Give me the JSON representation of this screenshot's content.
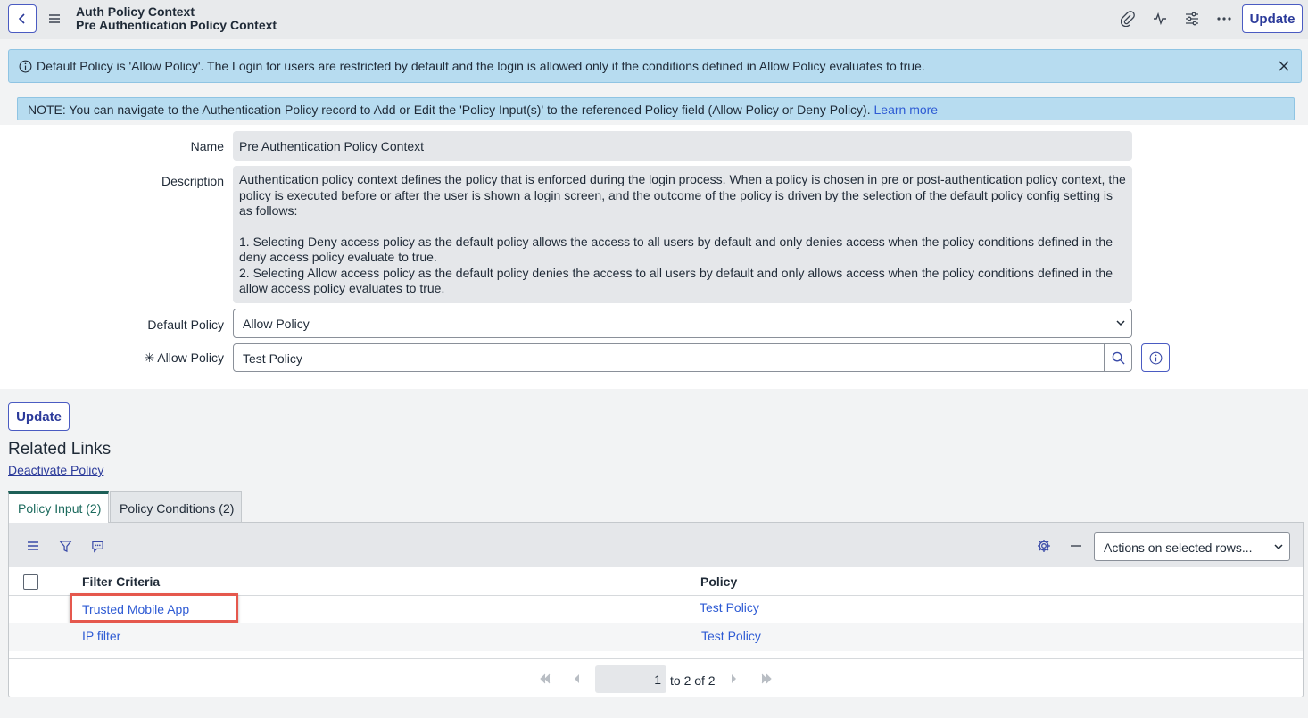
{
  "header": {
    "title": "Auth Policy Context",
    "subtitle": "Pre Authentication Policy Context",
    "update_label": "Update",
    "icons": [
      "back-icon",
      "menu-icon",
      "paperclip-icon",
      "activity-icon",
      "sliders-icon",
      "more-icon"
    ]
  },
  "info_banner": {
    "message": "Default Policy is 'Allow Policy'. The Login for users are restricted by default and the login is allowed only if the conditions defined in Allow Policy evaluates to true."
  },
  "note_banner": {
    "message": "NOTE: You can navigate to the Authentication Policy record to Add or Edit the 'Policy Input(s)' to the referenced Policy field (Allow Policy or Deny Policy).",
    "link": "Learn more"
  },
  "form": {
    "name_label": "Name",
    "name_value": "Pre Authentication Policy Context",
    "description_label": "Description",
    "description_p1": "Authentication policy context defines the policy that is enforced during the login process. When a policy is chosen in pre or post-authentication policy context, the policy is executed before or after the user is shown a login screen, and the outcome of the policy is driven by the selection of the default policy config setting is as follows:",
    "description_p2": "1. Selecting Deny access policy as the default policy allows the access to all users by default and only denies access when the policy conditions defined in the deny access policy evaluate to true.",
    "description_p3": "2. Selecting Allow access policy as the default policy denies the access to all users by default and only allows access when the policy conditions defined in the allow access policy evaluates to true.",
    "default_policy_label": "Default Policy",
    "default_policy_value": "Allow Policy",
    "required_marker": "✳",
    "allow_policy_label": "Allow Policy",
    "allow_policy_value": "Test Policy"
  },
  "bottom": {
    "update_label": "Update",
    "related_links_title": "Related Links",
    "deactivate_link": "Deactivate Policy"
  },
  "tabs": [
    {
      "label": "Policy Input (2)",
      "active": true
    },
    {
      "label": "Policy Conditions (2)",
      "active": false
    }
  ],
  "list": {
    "actions_label": "Actions on selected rows...",
    "columns": [
      "Filter Criteria",
      "Policy"
    ],
    "rows": [
      {
        "filter": "Trusted Mobile App",
        "policy": "Test Policy"
      },
      {
        "filter": "IP filter",
        "policy": "Test Policy"
      }
    ],
    "pager": {
      "current": "1",
      "range_text": "to 2 of 2"
    }
  },
  "colors": {
    "accent": "#4a5bc2",
    "link": "#2e5bd4",
    "banner": "#b7dcf0",
    "active_tab": "#1d5f57",
    "highlight": "#e5584d"
  }
}
